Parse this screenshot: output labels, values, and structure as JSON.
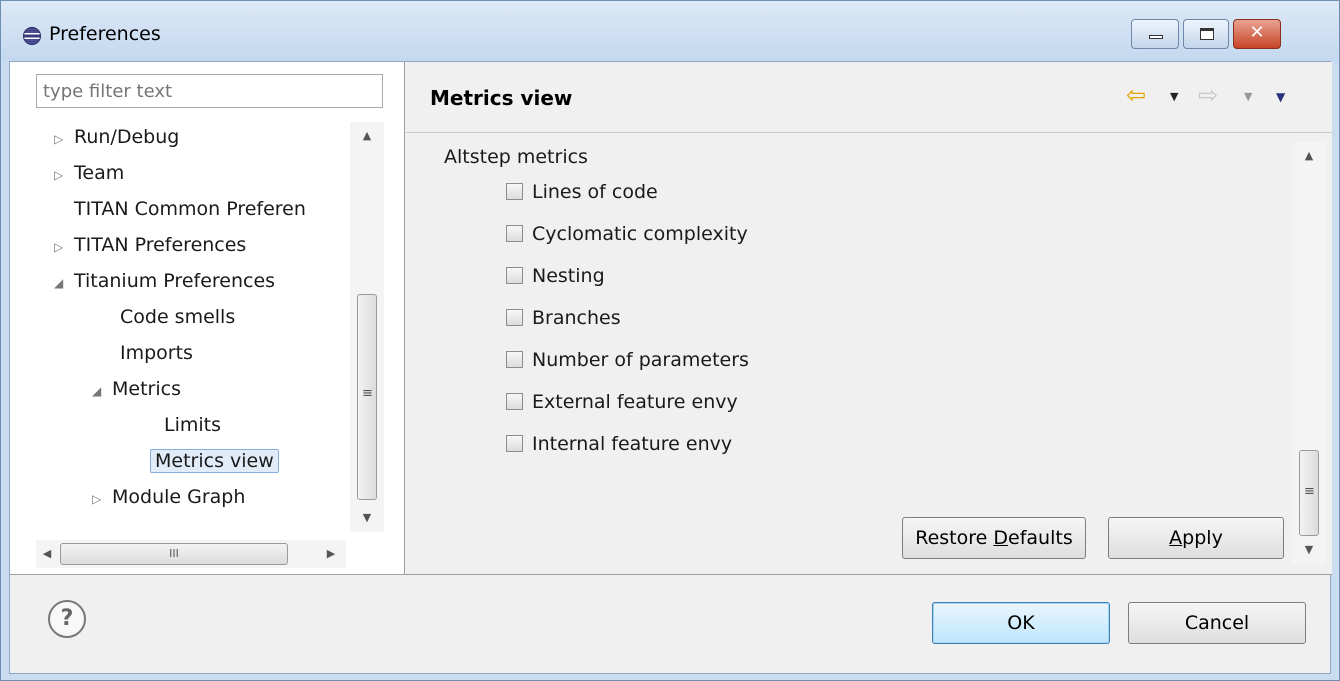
{
  "window": {
    "title": "Preferences",
    "close_glyph": "✕"
  },
  "left": {
    "filter_placeholder": "type filter text",
    "tree": [
      {
        "label": "Run/Debug",
        "expander": "▷"
      },
      {
        "label": "Team",
        "expander": "▷"
      },
      {
        "label": "TITAN Common Preferen",
        "expander": ""
      },
      {
        "label": "TITAN Preferences",
        "expander": "▷"
      },
      {
        "label": "Titanium Preferences",
        "expander": "◢"
      },
      {
        "label": "Code smells",
        "expander": ""
      },
      {
        "label": "Imports",
        "expander": ""
      },
      {
        "label": "Metrics",
        "expander": "◢"
      },
      {
        "label": "Limits",
        "expander": ""
      },
      {
        "label": "Metrics view",
        "expander": ""
      },
      {
        "label": "Module Graph",
        "expander": "▷"
      }
    ],
    "selected_index": 9,
    "hscroll_grip": "III"
  },
  "right": {
    "page_title": "Metrics view",
    "group_label": "Altstep metrics",
    "checkboxes": [
      {
        "label": "Lines of code",
        "checked": false
      },
      {
        "label": "Cyclomatic complexity",
        "checked": false
      },
      {
        "label": "Nesting",
        "checked": false
      },
      {
        "label": "Branches",
        "checked": false
      },
      {
        "label": "Number of parameters",
        "checked": false
      },
      {
        "label": "External feature envy",
        "checked": false
      },
      {
        "label": "Internal feature envy",
        "checked": false
      }
    ],
    "restore_pre": "Restore ",
    "restore_mnemonic": "D",
    "restore_post": "efaults",
    "apply_mnemonic": "A",
    "apply_post": "pply"
  },
  "footer": {
    "help_glyph": "?",
    "ok_label": "OK",
    "cancel_label": "Cancel"
  },
  "colors": {
    "accent": "#3c7fb1",
    "selection": "#e2ecf8",
    "back_arrow": "#e2a300"
  }
}
